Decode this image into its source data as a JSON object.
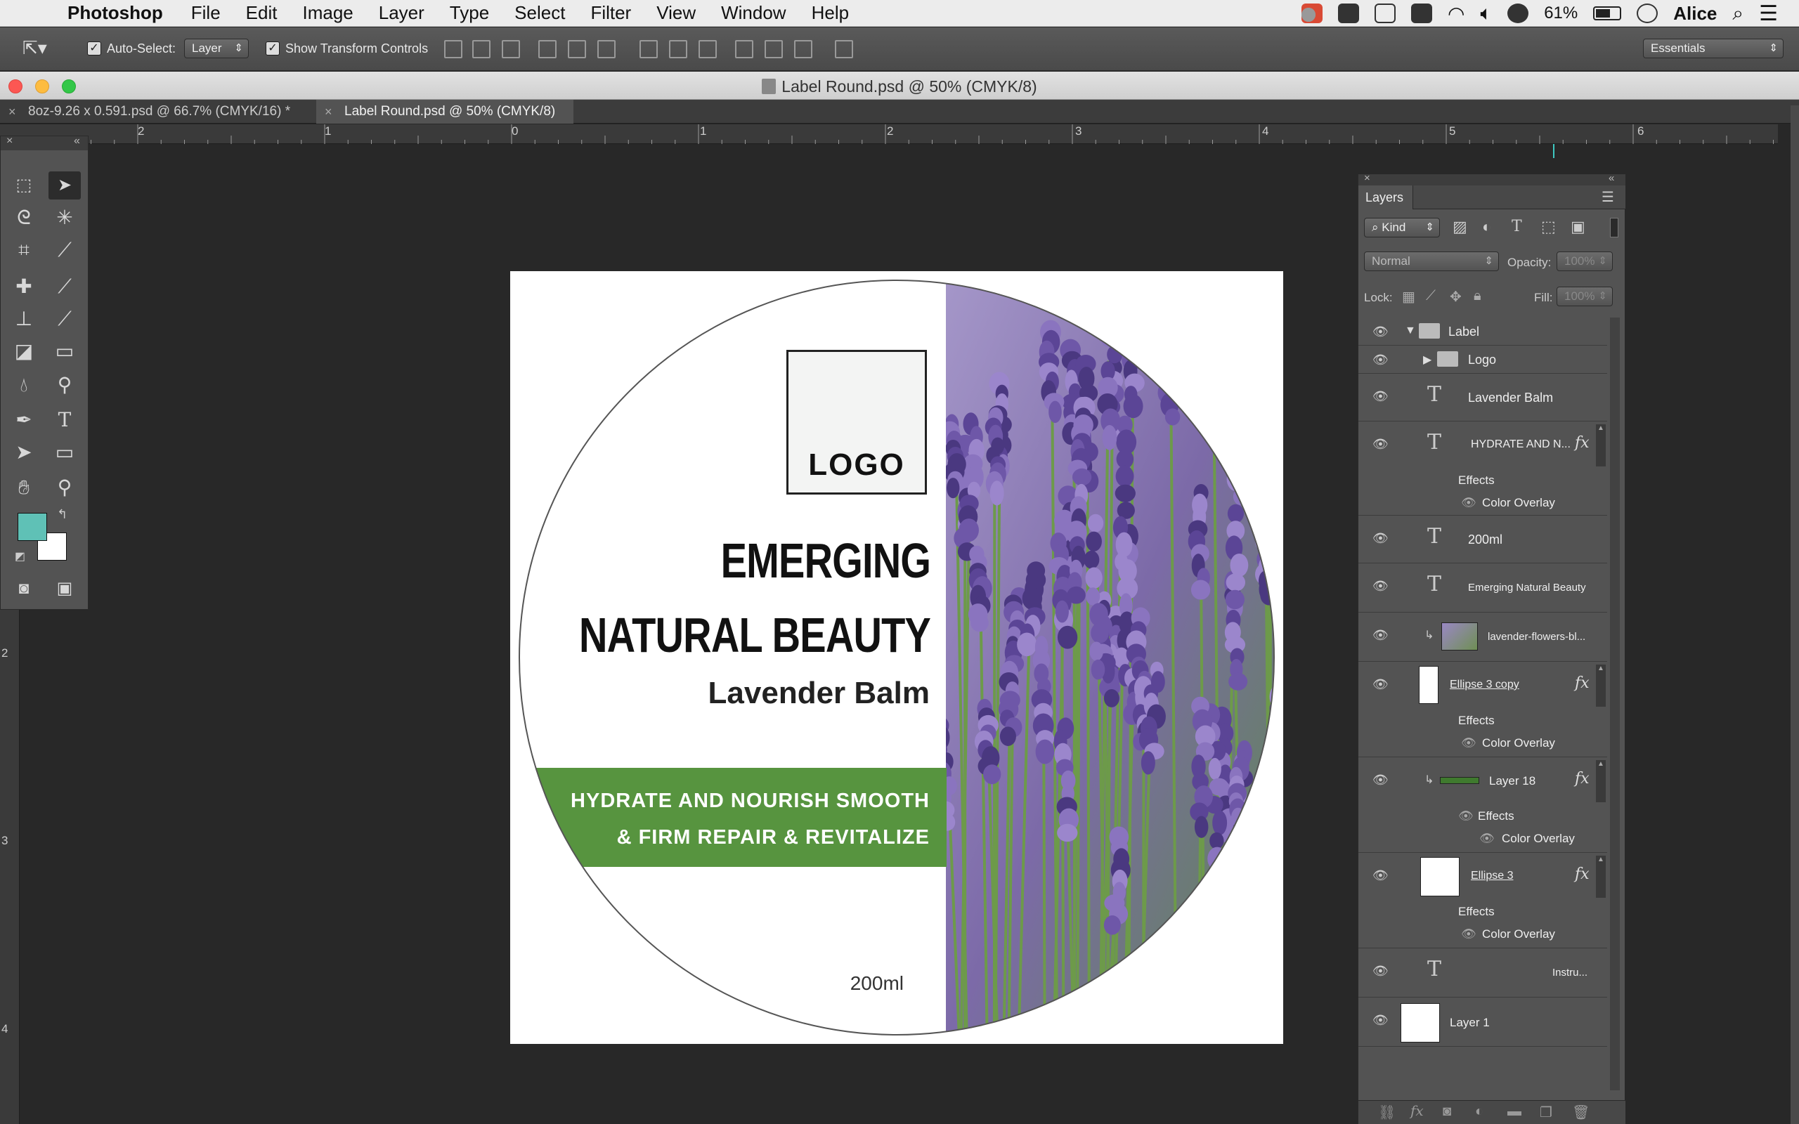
{
  "menubar": {
    "app": "Photoshop",
    "items": [
      "File",
      "Edit",
      "Image",
      "Layer",
      "Type",
      "Select",
      "Filter",
      "View",
      "Window",
      "Help"
    ],
    "battery": "61%",
    "user": "Alice"
  },
  "options": {
    "auto_select_label": "Auto-Select:",
    "auto_select_value": "Layer",
    "transform_label": "Show Transform Controls",
    "workspace": "Essentials"
  },
  "window": {
    "title": "Label Round.psd @ 50% (CMYK/8)"
  },
  "tabs": [
    {
      "label": "8oz-9.26 x 0.591.psd @ 66.7% (CMYK/16) *"
    },
    {
      "label": "Label Round.psd @ 50% (CMYK/8)"
    }
  ],
  "ruler": {
    "top": [
      "2",
      "1",
      "0",
      "1",
      "2",
      "3",
      "4",
      "5",
      "6"
    ],
    "left": [
      "2",
      "3",
      "4"
    ]
  },
  "label": {
    "logo": "LOGO",
    "headline1": "EMERGING",
    "headline2": "NATURAL BEAUTY",
    "product": "Lavender Balm",
    "band1": "HYDRATE AND NOURISH SMOOTH",
    "band2": "& FIRM REPAIR & REVITALIZE",
    "volume": "200ml",
    "band_color": "#57943f"
  },
  "layers": {
    "title": "Layers",
    "kind": "Kind",
    "blend": "Normal",
    "opacity_label": "Opacity:",
    "opacity": "100%",
    "lock_label": "Lock:",
    "fill_label": "Fill:",
    "fill": "100%",
    "effects": "Effects",
    "color_overlay": "Color Overlay",
    "items": [
      "Label",
      "Logo",
      "Lavender Balm",
      "HYDRATE AND N...",
      "200ml",
      "Emerging Natural Beauty",
      "lavender-flowers-bl...",
      "Ellipse 3 copy",
      "Layer 18",
      "Ellipse 3",
      "Instru...",
      "Layer 1"
    ]
  },
  "colors": {
    "foreground": "#5fc1b6",
    "background": "#ffffff"
  }
}
